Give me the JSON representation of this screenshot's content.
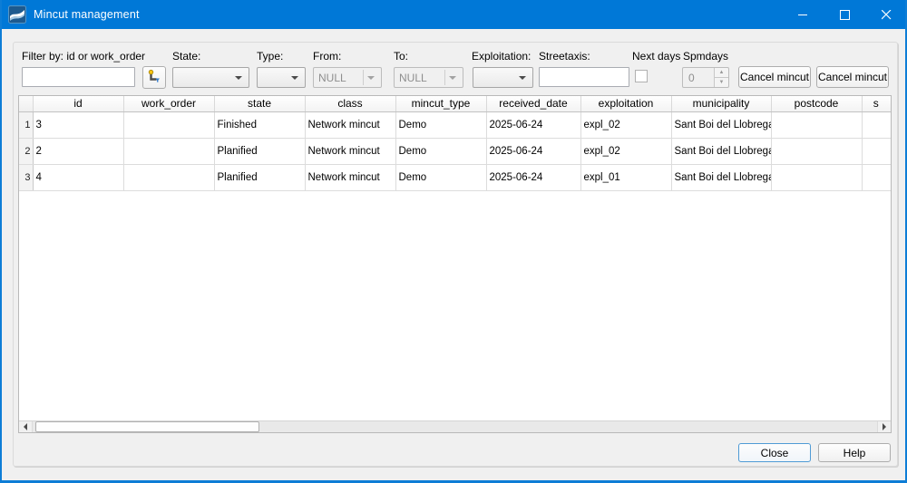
{
  "colors": {
    "titlebar": "#0078d7",
    "window_border": "#0d7dd6",
    "focus_border": "#4f9bd5",
    "panel_bg": "#f0f0f0"
  },
  "icons": {
    "app_icon": "giswater-wave-logo",
    "filter_tool_icon": "select-mincut-on-map",
    "minimize": "minimize-glyph",
    "maximize": "maximize-glyph",
    "close": "close-glyph"
  },
  "window": {
    "title": "Mincut management"
  },
  "filters": {
    "filter_by_label": "Filter by: id or work_order",
    "filter_by_value": "",
    "state_label": "State:",
    "state_value": "",
    "type_label": "Type:",
    "type_value": "",
    "from_label": "From:",
    "from_value": "NULL",
    "to_label": "To:",
    "to_value": "NULL",
    "exploitation_label": "Exploitation:",
    "exploitation_value": "",
    "streetaxis_label": "Streetaxis:",
    "streetaxis_value": "",
    "next_days_label": "Next days",
    "next_days_checked": false,
    "spmdays_label": "Spmdays",
    "spmdays_value": "0",
    "cancel_mincut_button": "Cancel mincut",
    "cancel_mincut_button2": "Cancel mincut"
  },
  "table": {
    "columns": [
      "id",
      "work_order",
      "state",
      "class",
      "mincut_type",
      "received_date",
      "exploitation",
      "municipality",
      "postcode",
      "s"
    ],
    "rows": [
      {
        "num": "1",
        "id": "3",
        "work_order": "",
        "state": "Finished",
        "class": "Network mincut",
        "mincut_type": "Demo",
        "received_date": "2025-06-24",
        "exploitation": "expl_02",
        "municipality": "Sant Boi del Llobregat",
        "postcode": "",
        "extra": ""
      },
      {
        "num": "2",
        "id": "2",
        "work_order": "",
        "state": "Planified",
        "class": "Network mincut",
        "mincut_type": "Demo",
        "received_date": "2025-06-24",
        "exploitation": "expl_02",
        "municipality": "Sant Boi del Llobregat",
        "postcode": "",
        "extra": ""
      },
      {
        "num": "3",
        "id": "4",
        "work_order": "",
        "state": "Planified",
        "class": "Network mincut",
        "mincut_type": "Demo",
        "received_date": "2025-06-24",
        "exploitation": "expl_01",
        "municipality": "Sant Boi del Llobregat",
        "postcode": "",
        "extra": ""
      }
    ]
  },
  "footer": {
    "close_label": "Close",
    "help_label": "Help"
  }
}
